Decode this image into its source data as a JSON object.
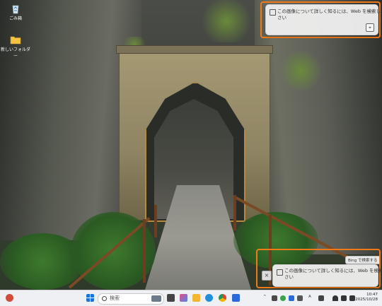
{
  "desktop": {
    "icons": [
      {
        "label": "ごみ箱",
        "icon": "recycle-bin-icon"
      },
      {
        "label": "新しいフォルダー",
        "icon": "folder-icon"
      }
    ]
  },
  "notification_top": {
    "text_line1": "この画像について詳しく知るには、Web を検索してくだ",
    "text_line2": "さい",
    "more": "...",
    "lens_icon": "lens-icon"
  },
  "notification_bottom": {
    "text_line1": "この画像について詳しく知るには、Web を検索してくだ",
    "text_line2": "さい",
    "search_chip": "Bing で検索する",
    "close": "×"
  },
  "taskbar": {
    "search_placeholder": "検索",
    "tray_chevron": "^",
    "ime": "A",
    "time": "10:47",
    "date": "2025/10/28",
    "colors": {
      "accent": "#f07a1a",
      "taskbar_bg": "#eef0f3"
    }
  }
}
